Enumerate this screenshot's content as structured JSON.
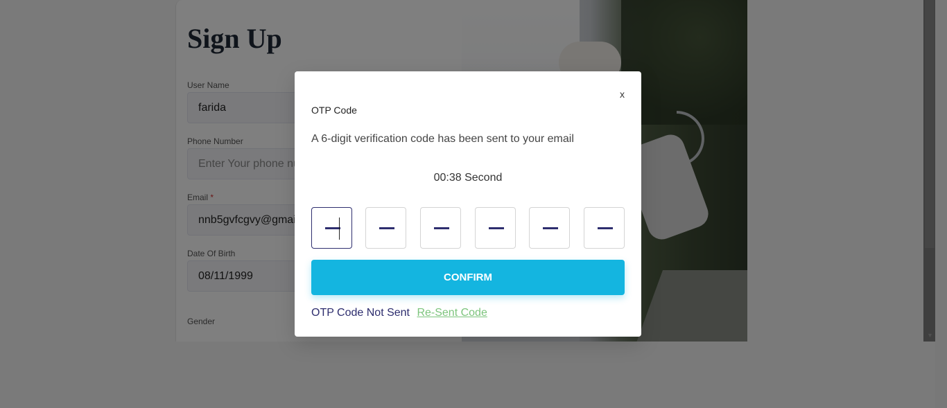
{
  "signup": {
    "title": "Sign Up",
    "username_label": "User Name",
    "username_value": "farida",
    "phone_label": "Phone Number",
    "phone_placeholder": "Enter Your phone nu",
    "email_label": "Email",
    "email_required": "*",
    "email_value": "nnb5gvfcgvy@gmai",
    "dob_label": "Date Of Birth",
    "dob_value": "08/11/1999",
    "gender_label": "Gender"
  },
  "modal": {
    "close_label": "x",
    "title": "OTP Code",
    "description": "A 6-digit verification code has been sent to your email",
    "timer": "00:38 Second",
    "confirm_label": "CONFIRM",
    "not_sent_text": "OTP Code Not Sent",
    "resend_label": "Re-Sent Code"
  },
  "colors": {
    "accent": "#14b5e0",
    "otp_dash": "#2d2d6e",
    "resend_link": "#7cc47c"
  }
}
